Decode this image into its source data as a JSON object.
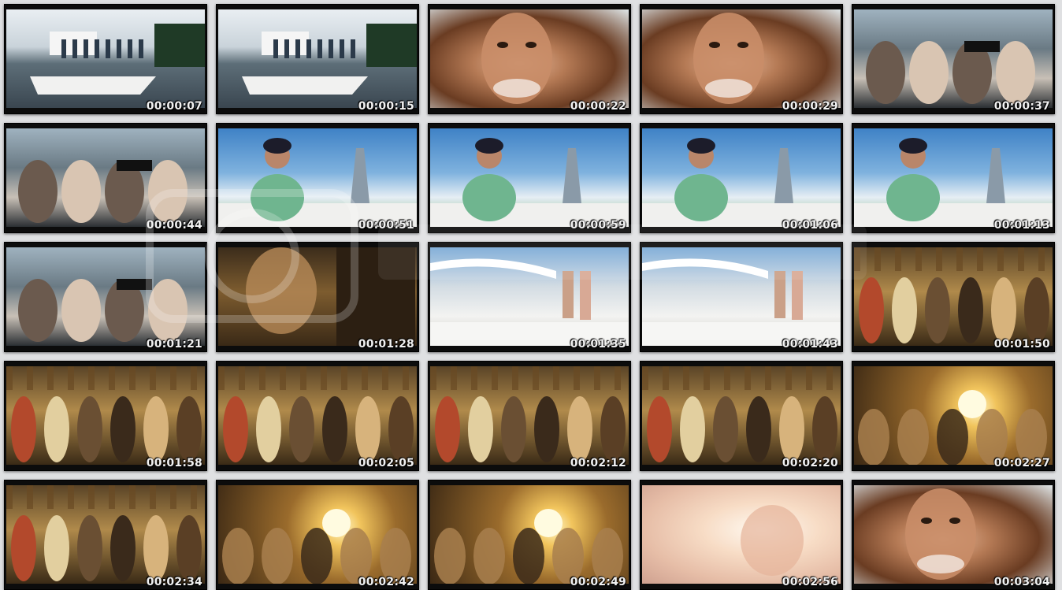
{
  "thumbnails": [
    {
      "time": "00:00:07",
      "scene": "boat"
    },
    {
      "time": "00:00:15",
      "scene": "boat"
    },
    {
      "time": "00:00:22",
      "scene": "face"
    },
    {
      "time": "00:00:29",
      "scene": "face"
    },
    {
      "time": "00:00:37",
      "scene": "party"
    },
    {
      "time": "00:00:44",
      "scene": "party"
    },
    {
      "time": "00:00:51",
      "scene": "sky"
    },
    {
      "time": "00:00:59",
      "scene": "sky"
    },
    {
      "time": "00:01:06",
      "scene": "sky"
    },
    {
      "time": "00:01:13",
      "scene": "sky"
    },
    {
      "time": "00:01:21",
      "scene": "party"
    },
    {
      "time": "00:01:28",
      "scene": "dark"
    },
    {
      "time": "00:01:35",
      "scene": "deck"
    },
    {
      "time": "00:01:43",
      "scene": "deck"
    },
    {
      "time": "00:01:50",
      "scene": "club"
    },
    {
      "time": "00:01:58",
      "scene": "club"
    },
    {
      "time": "00:02:05",
      "scene": "club"
    },
    {
      "time": "00:02:12",
      "scene": "club"
    },
    {
      "time": "00:02:20",
      "scene": "club"
    },
    {
      "time": "00:02:27",
      "scene": "flare"
    },
    {
      "time": "00:02:34",
      "scene": "club"
    },
    {
      "time": "00:02:42",
      "scene": "flare"
    },
    {
      "time": "00:02:49",
      "scene": "flare"
    },
    {
      "time": "00:02:56",
      "scene": "bright"
    },
    {
      "time": "00:03:04",
      "scene": "face"
    }
  ],
  "watermark_icon": "camera-watermark-icon"
}
